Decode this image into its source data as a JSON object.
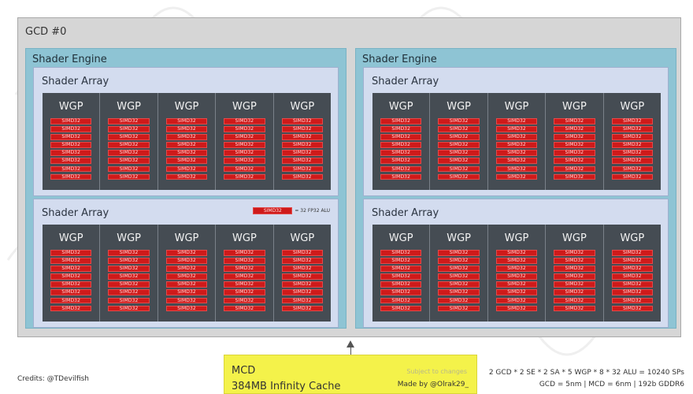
{
  "gcd": {
    "title": "GCD #0"
  },
  "shader_engines": [
    {
      "title": "Shader Engine",
      "arrays": [
        {
          "title": "Shader Array",
          "wgps": [
            "WGP",
            "WGP",
            "WGP",
            "WGP",
            "WGP"
          ]
        },
        {
          "title": "Shader Array",
          "wgps": [
            "WGP",
            "WGP",
            "WGP",
            "WGP",
            "WGP"
          ]
        }
      ]
    },
    {
      "title": "Shader Engine",
      "arrays": [
        {
          "title": "Shader Array",
          "wgps": [
            "WGP",
            "WGP",
            "WGP",
            "WGP",
            "WGP"
          ]
        },
        {
          "title": "Shader Array",
          "wgps": [
            "WGP",
            "WGP",
            "WGP",
            "WGP",
            "WGP"
          ]
        }
      ]
    }
  ],
  "simd": {
    "label": "SIMD32",
    "per_wgp": 8
  },
  "legend": {
    "box_label": "SIMD32",
    "text": "= 32 FP32 ALU"
  },
  "mcd": {
    "title": "MCD",
    "subtitle": "384MB Infinity Cache",
    "subject": "Subject to changes",
    "made_by": "Made by @Olrak29_"
  },
  "credits": "Credits: @TDevilfish",
  "specs": {
    "line1": "2 GCD * 2 SE * 2 SA * 5 WGP * 8 * 32 ALU = 10240 SPs",
    "line2": "GCD = 5nm | MCD = 6nm | 192b GDDR6"
  },
  "colors": {
    "gcd_bg": "#d6d6d6",
    "shader_engine_bg": "#8ec4d4",
    "shader_array_bg": "#d3dcef",
    "wgp_bg": "#454c53",
    "simd_red": "#cf1a1a",
    "mcd_yellow": "#f4f24a"
  }
}
